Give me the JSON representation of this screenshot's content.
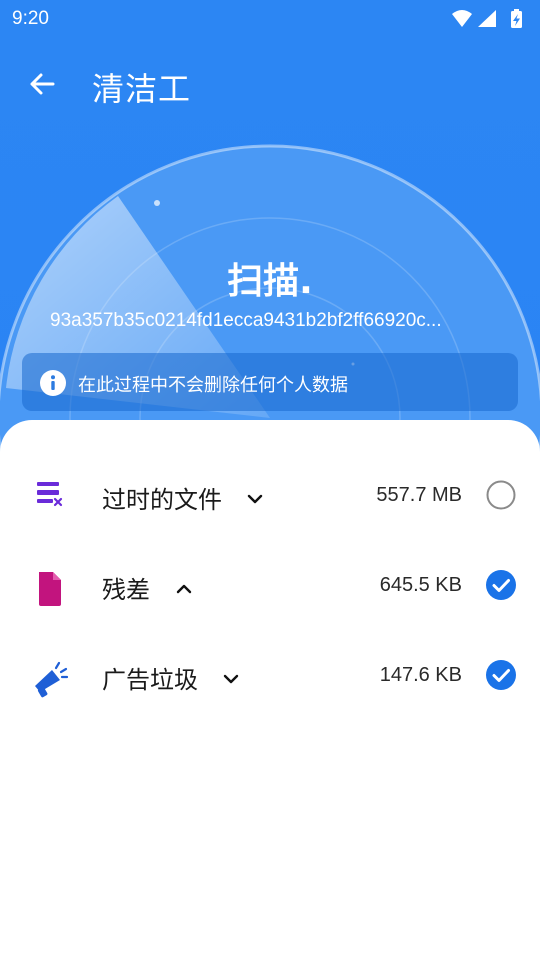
{
  "status_bar": {
    "time": "9:20",
    "icons": [
      "wifi-icon",
      "signal-icon",
      "battery-charging-icon"
    ]
  },
  "app_bar": {
    "title": "清洁工",
    "back_icon": "arrow-back-icon"
  },
  "scanner": {
    "title": "扫描.",
    "current_path": "93a357b35c0214fd1ecca9431b2bf2ff66920c...",
    "notice_icon": "info-icon",
    "notice": "在此过程中不会删除任何个人数据"
  },
  "colors": {
    "primary": "#2C86F3",
    "check": "#1A73E8",
    "purple": "#6A2BD9",
    "magenta": "#C2147E",
    "blue_icon": "#1F5FD6"
  },
  "items": [
    {
      "label": "过时的文件",
      "size": "557.7 MB",
      "checked": false,
      "expanded": false,
      "icon": "obsolete-files-icon"
    },
    {
      "label": "残差",
      "size": "645.5 KB",
      "checked": true,
      "expanded": true,
      "icon": "residual-file-icon"
    },
    {
      "label": "广告垃圾",
      "size": "147.6 KB",
      "checked": true,
      "expanded": false,
      "icon": "ad-junk-megaphone-icon"
    }
  ]
}
